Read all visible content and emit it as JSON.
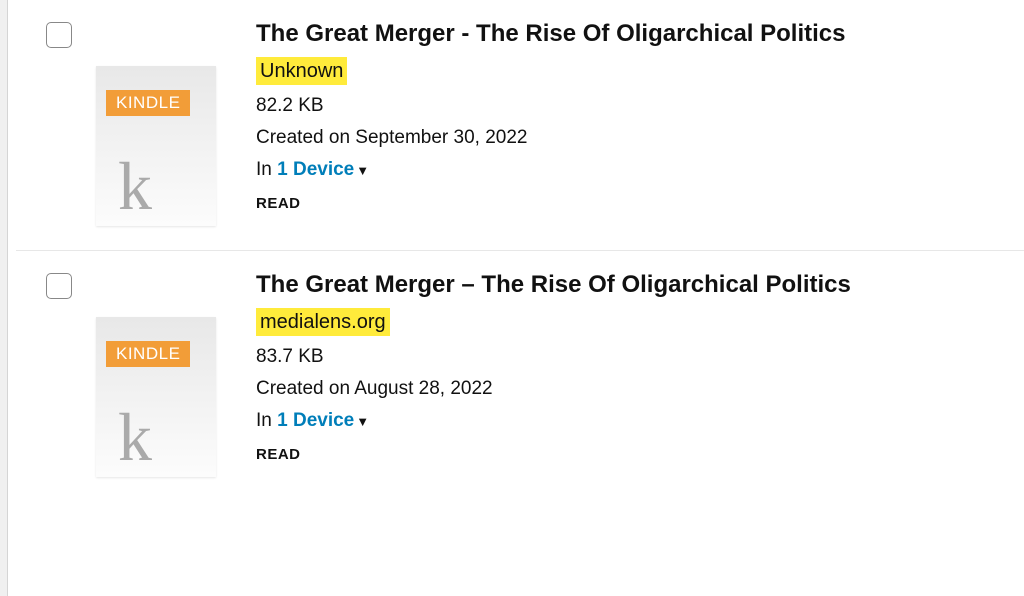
{
  "items": [
    {
      "badge": "KINDLE",
      "thumb_letter": "k",
      "title": "The Great Merger - The Rise Of Oligarchical Politics",
      "author": "Unknown",
      "size": "82.2 KB",
      "created": "Created on September 30, 2022",
      "devices_prefix": "In ",
      "devices_link": "1 Device",
      "read_label": "READ"
    },
    {
      "badge": "KINDLE",
      "thumb_letter": "k",
      "title": "The Great Merger – The Rise Of Oligarchical Politics",
      "author": "medialens.org",
      "size": "83.7 KB",
      "created": "Created on August 28, 2022",
      "devices_prefix": "In ",
      "devices_link": "1 Device",
      "read_label": "READ"
    }
  ]
}
